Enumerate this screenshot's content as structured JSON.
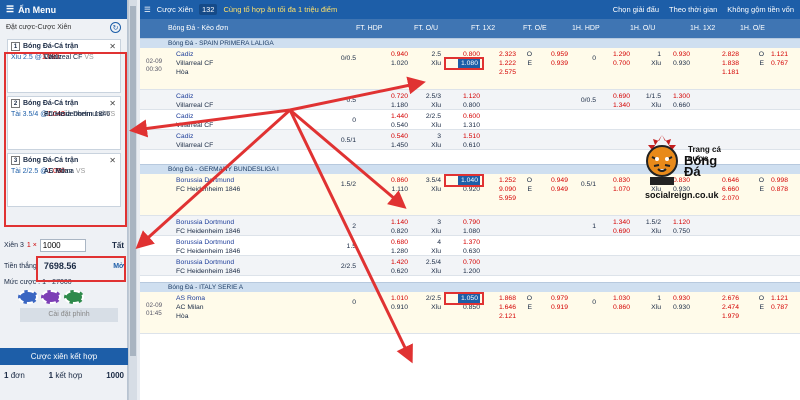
{
  "left": {
    "header": "Ẩn Menu",
    "sub": "Đặt cược-Cược Xiên",
    "slips": [
      {
        "num": "1",
        "title": "Bóng Đá-Cá trận",
        "team1": "Villarreal CF",
        "vs": "VS",
        "team2": "Cadiz",
        "pick": "Xỉu 2.5",
        "odds": "1.080"
      },
      {
        "num": "2",
        "title": "Bóng Đá-Cá trận",
        "team1": "Borussia Dortmund",
        "vs": "VS",
        "team2": "FC Heidenheim 1846",
        "pick": "Tài 3.5/4",
        "odds": "1.040"
      },
      {
        "num": "3",
        "title": "Bóng Đá-Cá trận",
        "team1": "AS Roma",
        "vs": "VS",
        "team2": "AC Milan",
        "pick": "Tài 2/2.5",
        "odds": "1.050"
      }
    ],
    "xien_label": "Xiên 3",
    "xien_mult": "1 ×",
    "stake": "1000",
    "all_label": "Tất",
    "win_label": "Tiền thắng",
    "win_value": "7698.56",
    "open_label": "Mở",
    "range_label": "Mức cược : 1 - 27000",
    "set_chip": "Cài đặt phỉnh",
    "combo_btn": "Cược xiên kết hợp",
    "combo_row": {
      "a": "1",
      "a_label": "đơn",
      "b": "1",
      "b_label": "kết hợp",
      "c": "1000"
    }
  },
  "topbar": {
    "label": "Cược Xiên",
    "count": "132",
    "promo": "Cùng tổ hợp ăn tối đa 1 triệu điểm",
    "opt1": "Chọn giải đấu",
    "opt2": "Theo thời gian",
    "opt3": "Không gộm tiền vốn"
  },
  "columns": {
    "title": "Bóng Đá - Kèo đơn",
    "c1": "FT. HDP",
    "c2": "FT. O/U",
    "c3": "FT. 1X2",
    "c4": "FT. O/E",
    "c5": "1H. HDP",
    "c6": "1H. O/U",
    "c7": "1H. 1X2",
    "c8": "1H. O/E"
  },
  "leagues": [
    "Bóng Đá - SPAIN PRIMERA LALIGA",
    "Bóng Đá - GERMANY BUNDESLIGA I",
    "Bóng Đá - ITALY SERIE A"
  ],
  "rows": [
    {
      "date": "02-09",
      "time": "00:30",
      "t1": "Cadiz",
      "t2": "Villarreal CF",
      "t3": "Hòa",
      "hdp": "0/0.5",
      "h1": "0.940",
      "h2": "1.020",
      "ou": "2.5",
      "ou_x": "Xỉu",
      "o1": "0.800",
      "o2": "1.080",
      "x1": "2.323",
      "x2": "1.222",
      "x3": "2.575",
      "e1": "0.959",
      "e2": "0.939",
      "hh": "0",
      "hh1": "1.290",
      "hh2": "0.700",
      "ho": "1",
      "ho1": "0.930",
      "ho2": "0.930",
      "hx1": "2.828",
      "hx2": "1.838",
      "hx3": "1.181",
      "he1": "1.121",
      "he2": "0.767"
    },
    {
      "t1": "Cadiz",
      "t2": "Villarreal CF",
      "hdp": "0.5",
      "h1": "0.720",
      "h2": "1.180",
      "ou": "2.5/3",
      "ou_x": "Xỉu",
      "o1": "1.120",
      "o2": "0.800",
      "hh": "0/0.5",
      "hh1": "0.690",
      "hh2": "1.340",
      "ho": "1/1.5",
      "ho1": "1.300",
      "ho2": "0.660"
    },
    {
      "t1": "Cadiz",
      "t2": "Villarreal CF",
      "hdp": "0",
      "h1": "1.440",
      "h2": "0.540",
      "ou": "2/2.5",
      "ou_x": "Xỉu",
      "o1": "0.600",
      "o2": "1.310"
    },
    {
      "t1": "Cadiz",
      "t2": "Villarreal CF",
      "hdp": "0.5/1",
      "h1": "0.540",
      "h2": "1.450",
      "ou": "3",
      "ou_x": "Xỉu",
      "o1": "1.510",
      "o2": "0.610"
    },
    {
      "t1": "Borussia Dortmund",
      "t2": "FC Heidenheim 1846",
      "hdp": "1.5/2",
      "h1": "0.860",
      "h2": "1.110",
      "ou": "3.5/4",
      "ou_x": "Xỉu",
      "o1": "1.040",
      "o2": "0.920",
      "x1": "1.252",
      "x2": "9.090",
      "x3": "5.959",
      "e1": "0.949",
      "e2": "0.949",
      "hh": "0.5/1",
      "hh1": "0.830",
      "hh2": "1.070",
      "ho": "1.5",
      "ho1": "0.830",
      "ho2": "0.930",
      "hx1": "0.646",
      "hx2": "6.660",
      "hx3": "2.070",
      "he1": "0.998",
      "he2": "0.878"
    },
    {
      "t1": "Borussia Dortmund",
      "t2": "FC Heidenheim 1846",
      "hdp": "2",
      "h1": "1.140",
      "h2": "0.820",
      "ou": "3",
      "ou_x": "Xỉu",
      "o1": "0.790",
      "o2": "1.080",
      "hh": "1",
      "hh1": "1.340",
      "hh2": "0.690",
      "ho": "1.5/2",
      "ho1": "1.120",
      "ho2": "0.750"
    },
    {
      "t1": "Borussia Dortmund",
      "t2": "FC Heidenheim 1846",
      "hdp": "1.5",
      "h1": "0.680",
      "h2": "1.280",
      "ou": "4",
      "ou_x": "Xỉu",
      "o1": "1.370",
      "o2": "0.630"
    },
    {
      "t1": "Borussia Dortmund",
      "t2": "FC Heidenheim 1846",
      "hdp": "2/2.5",
      "h1": "1.420",
      "h2": "0.620",
      "ou": "2.5/4",
      "ou_x": "Xỉu",
      "o1": "0.700",
      "o2": "1.200"
    },
    {
      "date": "02-09",
      "time": "01:45",
      "t1": "AS Roma",
      "t2": "AC Milan",
      "t3": "Hòa",
      "hdp": "0",
      "h1": "1.010",
      "h2": "0.910",
      "ou": "2/2.5",
      "ou_x": "Xỉu",
      "o1": "1.050",
      "o2": "0.850",
      "x1": "1.868",
      "x2": "1.646",
      "x3": "2.121",
      "e1": "0.979",
      "e2": "0.919",
      "hh": "0",
      "hh1": "1.030",
      "hh2": "0.860",
      "ho": "1",
      "ho1": "0.930",
      "ho2": "0.930",
      "hx1": "2.676",
      "hx2": "2.474",
      "hx3": "1.979",
      "he1": "1.121",
      "he2": "0.787"
    }
  ],
  "logo": {
    "l1": "Trang cá",
    "l2": "cược",
    "l3": "Bóng",
    "l4": "Đá",
    "url": "socialreign.co.uk"
  }
}
